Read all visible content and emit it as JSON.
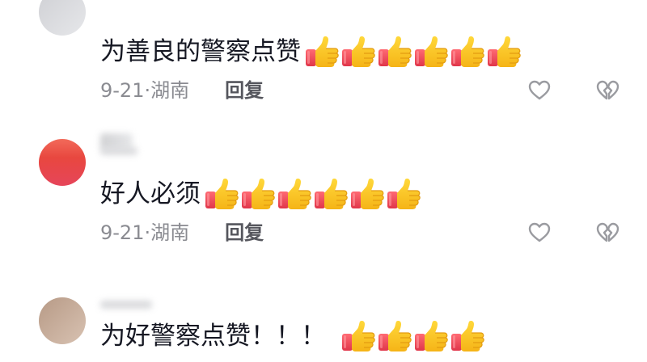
{
  "comments": [
    {
      "text": "为善良的警察点赞",
      "emoji_count": 6,
      "date": "9-21",
      "separator": "·",
      "location": "湖南",
      "reply_label": "回复"
    },
    {
      "text": "好人必须",
      "emoji_count": 6,
      "date": "9-21",
      "separator": "·",
      "location": "湖南",
      "reply_label": "回复"
    },
    {
      "text": "为好警察点赞！！！",
      "emoji_count": 4
    }
  ],
  "icons": {
    "like": "heart-outline-icon",
    "dislike": "broken-heart-icon",
    "emoji": "thumbs-up-emoji"
  },
  "colors": {
    "text": "#161823",
    "meta": "#8a8b91",
    "reply": "#55565d",
    "icon": "#9a9ba0"
  }
}
